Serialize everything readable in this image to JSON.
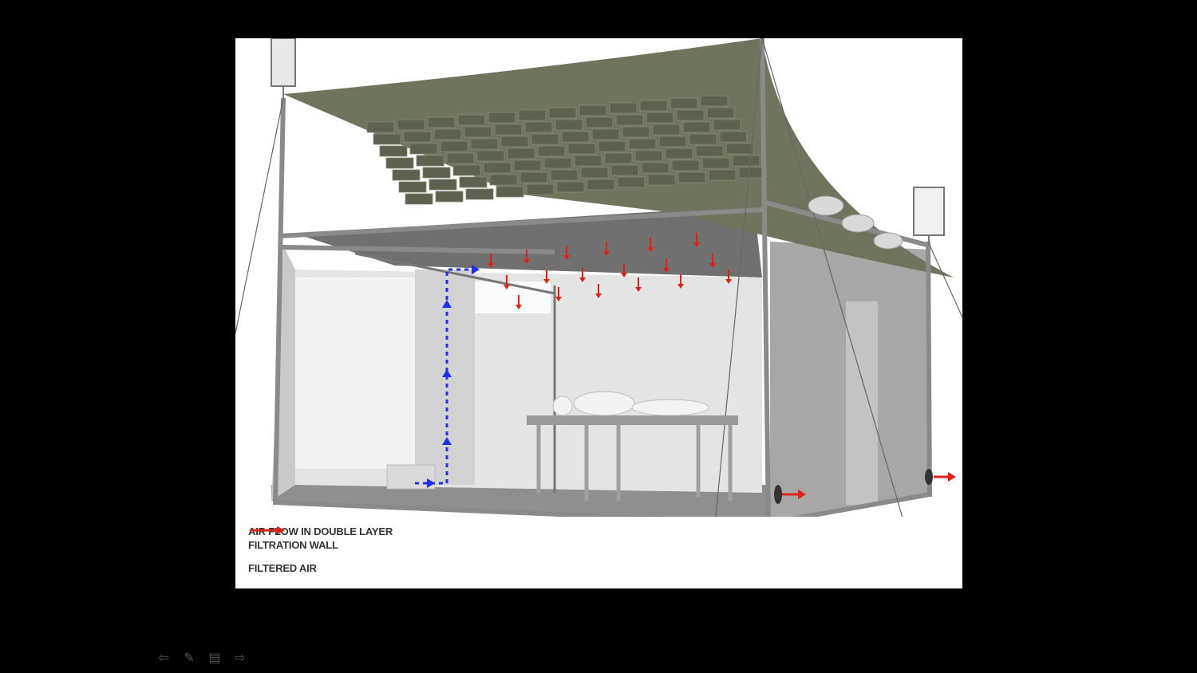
{
  "legend": {
    "blue_label_line1": "AIR FLOW IN DOUBLE LAYER",
    "blue_label_line2": "FILTRATION WALL",
    "red_label": "FILTERED AIR"
  },
  "colors": {
    "canopy": "#6f745f",
    "panel": "#5c6150",
    "frame": "#8a8a8a",
    "blue_arrow": "#1f2ff0",
    "red_arrow": "#e0211a",
    "background": "#000000"
  },
  "controls": [
    {
      "icon": "arrow-left-icon",
      "glyph": "⇦"
    },
    {
      "icon": "pencil-icon",
      "glyph": "✎"
    },
    {
      "icon": "menu-icon",
      "glyph": "▤"
    },
    {
      "icon": "arrow-right-icon",
      "glyph": "⇨"
    }
  ]
}
